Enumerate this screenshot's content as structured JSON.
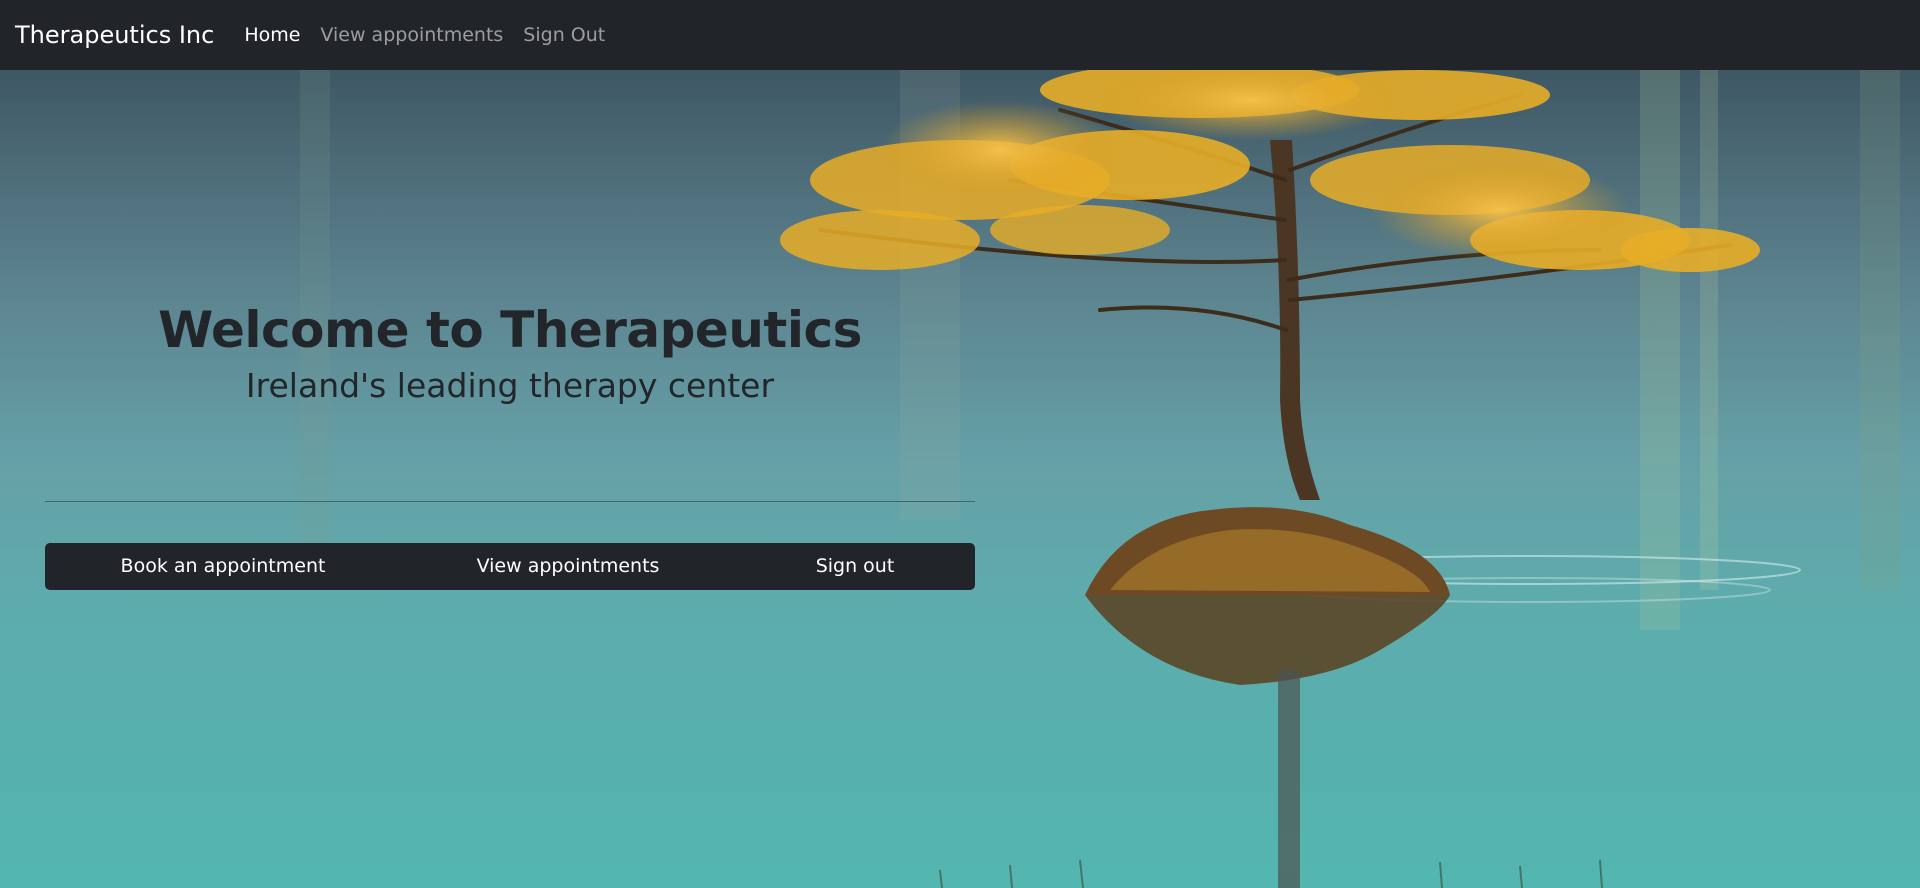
{
  "navbar": {
    "brand": "Therapeutics Inc",
    "links": [
      {
        "label": "Home",
        "active": true
      },
      {
        "label": "View appointments",
        "active": false
      },
      {
        "label": "Sign Out",
        "active": false
      }
    ]
  },
  "hero": {
    "title": "Welcome to Therapeutics",
    "subtitle": "Ireland's leading therapy center",
    "background_image": "lone-tree-on-lake",
    "buttons": [
      {
        "label": "Book an appointment"
      },
      {
        "label": "View appointments"
      },
      {
        "label": "Sign out"
      }
    ]
  },
  "colors": {
    "navbar": "#212529",
    "text_dark": "#22262b",
    "button_bg": "#212529",
    "foliage": "#e8b12a",
    "water": "#4fb0ac"
  }
}
